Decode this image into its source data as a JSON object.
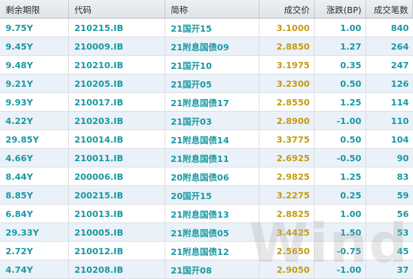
{
  "colors": {
    "teal": "#1a9aa3",
    "gold": "#c69b14",
    "stripe": "#eaf1f8"
  },
  "table": {
    "headers": [
      "剩余期限",
      "代码",
      "简称",
      "成交价",
      "涨跌(BP)",
      "成交笔数"
    ],
    "rows": [
      [
        "9.75Y",
        "210215.IB",
        "21国开15",
        "3.1000",
        "1.00",
        "840"
      ],
      [
        "9.45Y",
        "210009.IB",
        "21附息国债09",
        "2.8850",
        "1.27",
        "264"
      ],
      [
        "9.48Y",
        "210210.IB",
        "21国开10",
        "3.1975",
        "0.35",
        "247"
      ],
      [
        "9.21Y",
        "210205.IB",
        "21国开05",
        "3.2300",
        "0.50",
        "126"
      ],
      [
        "9.93Y",
        "210017.IB",
        "21附息国债17",
        "2.8550",
        "1.25",
        "114"
      ],
      [
        "4.22Y",
        "210203.IB",
        "21国开03",
        "2.8900",
        "-1.00",
        "110"
      ],
      [
        "29.85Y",
        "210014.IB",
        "21附息国债14",
        "3.3775",
        "0.50",
        "104"
      ],
      [
        "4.66Y",
        "210011.IB",
        "21附息国债11",
        "2.6925",
        "-0.50",
        "90"
      ],
      [
        "8.44Y",
        "200006.IB",
        "20附息国债06",
        "2.9825",
        "1.25",
        "83"
      ],
      [
        "8.85Y",
        "200215.IB",
        "20国开15",
        "3.2275",
        "0.25",
        "59"
      ],
      [
        "6.84Y",
        "210013.IB",
        "21附息国债13",
        "2.8825",
        "1.00",
        "56"
      ],
      [
        "29.33Y",
        "210005.IB",
        "21附息国债05",
        "3.4425",
        "1.50",
        "53"
      ],
      [
        "2.72Y",
        "210012.IB",
        "21附息国债12",
        "2.5650",
        "-0.75",
        "45"
      ],
      [
        "4.74Y",
        "210208.IB",
        "21国开08",
        "2.9050",
        "-1.00",
        "37"
      ]
    ]
  },
  "watermark": "Wind"
}
